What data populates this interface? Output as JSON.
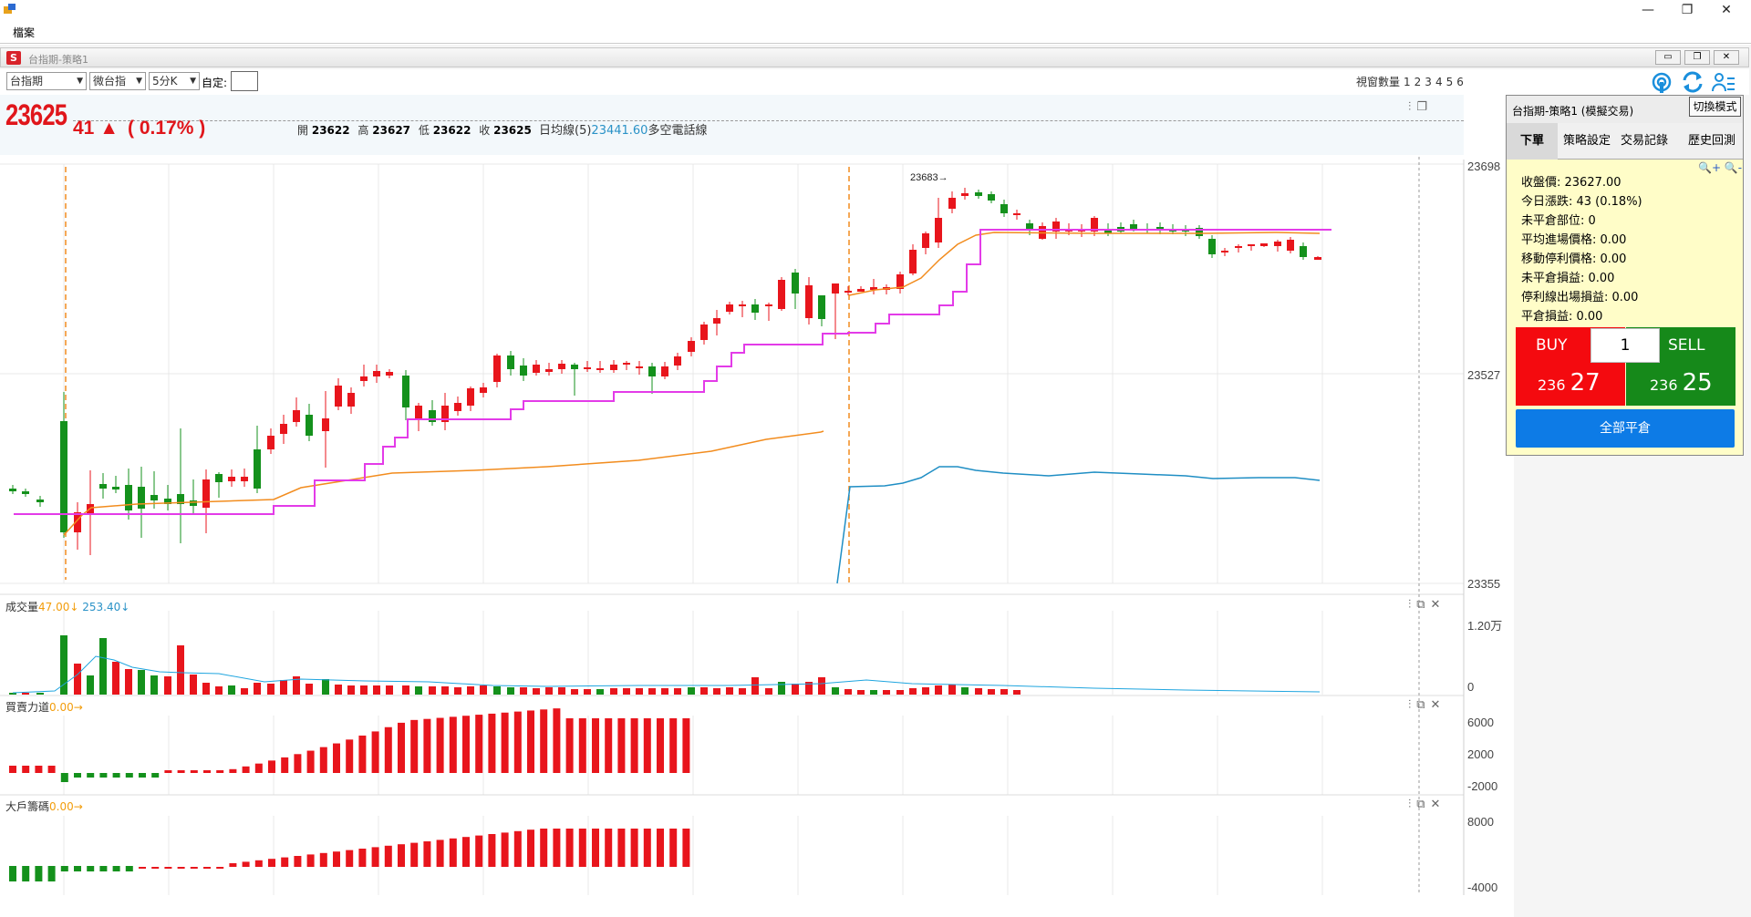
{
  "window": {
    "minimize": "—",
    "restore": "❐",
    "close": "✕"
  },
  "menu": {
    "file": "檔案"
  },
  "child_window": {
    "title": "台指期-策略1",
    "icon_letter": "S",
    "btn_min": "▭",
    "btn_restore": "❐",
    "btn_close": "✕"
  },
  "toolbar": {
    "symbol": "台指期",
    "contract": "微台指",
    "period": "5分K",
    "custom_label": "自定:",
    "window_count_label": "視窗數量",
    "window_counts": [
      "1",
      "2",
      "3",
      "4",
      "5",
      "6"
    ]
  },
  "quote": {
    "price": "23625",
    "change": "41 ▲",
    "change_pct": "( 0.17% )",
    "open_label": "開",
    "open": "23622",
    "high_label": "高",
    "high": "23627",
    "low_label": "低",
    "low": "23622",
    "close_label": "收",
    "close": "23625",
    "ma_label": "日均線(5)",
    "ma_value": "23441.60",
    "bull_bear_label": "多空電話線"
  },
  "main_chart": {
    "y_labels": [
      "23698",
      "23527",
      "23355"
    ],
    "marker": "23683→",
    "colors": {
      "up": "#e8151c",
      "down": "#14911c",
      "ma": "#f28c1e",
      "line": "#e33be8",
      "blue": "#1f8ec4"
    }
  },
  "volume": {
    "title": "成交量",
    "v1": "47.00↓",
    "v2": "253.40↓",
    "y_labels": [
      "1.20万",
      "0"
    ]
  },
  "force": {
    "title": "買賣力道",
    "v": "0.00→",
    "y_labels": [
      "6000",
      "2000",
      "-2000"
    ]
  },
  "chips": {
    "title": "大戶籌碼",
    "v": "0.00→",
    "y_labels": [
      "8000",
      "-4000"
    ]
  },
  "panel": {
    "title": "台指期-策略1 (模擬交易)",
    "switch_mode": "切換模式",
    "tabs": [
      "下單",
      "策略設定",
      "交易記錄",
      "歷史回測"
    ],
    "zoom": "🔍+ 🔍-",
    "info": [
      "收盤價: 23627.00",
      "今日漲跌: 43 (0.18%)",
      "未平倉部位: 0",
      "平均進場價格: 0.00",
      "移動停利價格: 0.00",
      "未平倉損益: 0.00",
      "停利線出場損益: 0.00",
      "平倉損益: 0.00"
    ],
    "buy_label": "BUY",
    "buy_price_prefix": "236",
    "buy_price_suffix": "27",
    "qty": "1",
    "sell_label": "SELL",
    "sell_price_prefix": "236",
    "sell_price_suffix": "25",
    "close_all": "全部平倉"
  }
}
